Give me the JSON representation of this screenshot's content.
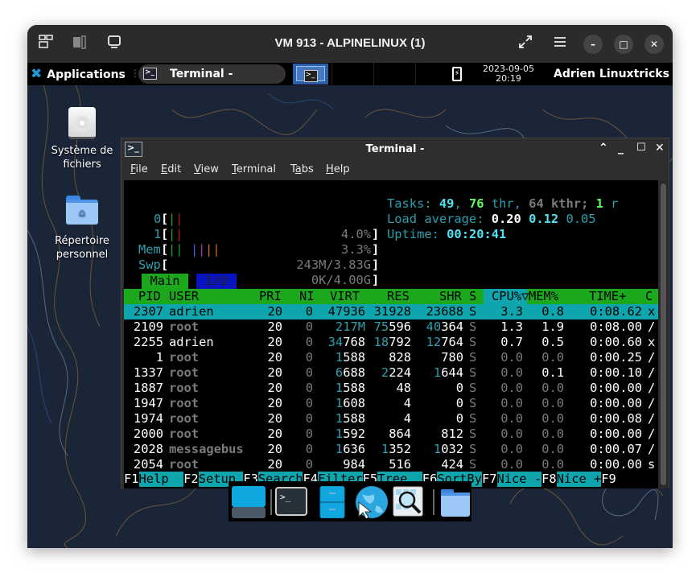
{
  "vm_window": {
    "title": "VM 913 - ALPINELINUX (1)",
    "left_icons": [
      "multi-screen-icon",
      "audio-device-icon",
      "monitor-icon"
    ],
    "right_icons": [
      "fullscreen-icon",
      "hamburger-menu-icon"
    ],
    "controls": {
      "minimize": "–",
      "maximize": "□",
      "close": "✕"
    }
  },
  "panel": {
    "applications_label": "Applications",
    "task_label": "Terminal -",
    "clock_date": "2023-09-05",
    "clock_time": "20:19",
    "user_name": "Adrien Linuxtricks"
  },
  "desktop_icons": [
    {
      "label_line1": "Système de",
      "label_line2": "fichiers",
      "icon": "hard-drive-icon"
    },
    {
      "label_line1": "Répertoire",
      "label_line2": "personnel",
      "icon": "home-folder-icon"
    }
  ],
  "terminal": {
    "title": "Terminal -",
    "menu": [
      {
        "label": "File",
        "mnemonic_index": 0
      },
      {
        "label": "Edit",
        "mnemonic_index": 0
      },
      {
        "label": "View",
        "mnemonic_index": 0
      },
      {
        "label": "Terminal",
        "mnemonic_index": 0
      },
      {
        "label": "Tabs",
        "mnemonic_index": 1
      },
      {
        "label": "Help",
        "mnemonic_index": 0
      }
    ]
  },
  "htop": {
    "cpu0": {
      "label": "0",
      "percent": "4.0%"
    },
    "cpu1": {
      "label": "1",
      "percent": "3.3%"
    },
    "mem": {
      "label": "Mem",
      "value": "243M/3.83G"
    },
    "swp": {
      "label": "Swp",
      "value": "0K/4.00G"
    },
    "tasks": {
      "label": "Tasks:",
      "count": "49",
      "thr": "76",
      "thr_label": "thr,",
      "kthr": "64 kthr;",
      "running": "1",
      "running_label": "r"
    },
    "load": {
      "label": "Load average:",
      "l1": "0.20",
      "l5": "0.12",
      "l15": "0.05"
    },
    "uptime": {
      "label": "Uptime:",
      "value": "00:20:41"
    },
    "tabs": [
      "Main",
      "I/O"
    ],
    "columns": [
      "PID",
      "USER",
      "PRI",
      "NI",
      "VIRT",
      "RES",
      "SHR",
      "S",
      "CPU%▽",
      "MEM%",
      "TIME+",
      "C"
    ],
    "processes": [
      {
        "pid": "2307",
        "user": "adrien",
        "pri": "20",
        "ni": "0",
        "virt": "47936",
        "res": "31928",
        "shr": "23688",
        "s": "S",
        "cpu": "3.3",
        "mem": "0.8",
        "time": "0:08.62",
        "cmd": "x",
        "selected": true
      },
      {
        "pid": "2109",
        "user": "root",
        "pri": "20",
        "ni": "0",
        "virt": "217M",
        "res": "75596",
        "shr": "40364",
        "s": "S",
        "cpu": "1.3",
        "mem": "1.9",
        "time": "0:08.00",
        "cmd": "/"
      },
      {
        "pid": "2255",
        "user": "adrien",
        "pri": "20",
        "ni": "0",
        "virt": "34768",
        "res": "18792",
        "shr": "12764",
        "s": "S",
        "cpu": "0.7",
        "mem": "0.5",
        "time": "0:00.60",
        "cmd": "x"
      },
      {
        "pid": "1",
        "user": "root",
        "pri": "20",
        "ni": "0",
        "virt": "1588",
        "res": "828",
        "shr": "780",
        "s": "S",
        "cpu": "0.0",
        "mem": "0.0",
        "time": "0:00.25",
        "cmd": "/"
      },
      {
        "pid": "1337",
        "user": "root",
        "pri": "20",
        "ni": "0",
        "virt": "6688",
        "res": "2224",
        "shr": "1644",
        "s": "S",
        "cpu": "0.0",
        "mem": "0.1",
        "time": "0:00.10",
        "cmd": "/"
      },
      {
        "pid": "1887",
        "user": "root",
        "pri": "20",
        "ni": "0",
        "virt": "1588",
        "res": "48",
        "shr": "0",
        "s": "S",
        "cpu": "0.0",
        "mem": "0.0",
        "time": "0:00.00",
        "cmd": "/"
      },
      {
        "pid": "1947",
        "user": "root",
        "pri": "20",
        "ni": "0",
        "virt": "1608",
        "res": "4",
        "shr": "0",
        "s": "S",
        "cpu": "0.0",
        "mem": "0.0",
        "time": "0:00.00",
        "cmd": "/"
      },
      {
        "pid": "1974",
        "user": "root",
        "pri": "20",
        "ni": "0",
        "virt": "1588",
        "res": "4",
        "shr": "0",
        "s": "S",
        "cpu": "0.0",
        "mem": "0.0",
        "time": "0:00.08",
        "cmd": "/"
      },
      {
        "pid": "2000",
        "user": "root",
        "pri": "20",
        "ni": "0",
        "virt": "1592",
        "res": "864",
        "shr": "812",
        "s": "S",
        "cpu": "0.0",
        "mem": "0.0",
        "time": "0:00.00",
        "cmd": "/"
      },
      {
        "pid": "2028",
        "user": "messagebus",
        "pri": "20",
        "ni": "0",
        "virt": "1636",
        "res": "1352",
        "shr": "1032",
        "s": "S",
        "cpu": "0.0",
        "mem": "0.0",
        "time": "0:00.07",
        "cmd": "/"
      },
      {
        "pid": "2054",
        "user": "root",
        "pri": "20",
        "ni": "0",
        "virt": "984",
        "res": "516",
        "shr": "424",
        "s": "S",
        "cpu": "0.0",
        "mem": "0.0",
        "time": "0:00.00",
        "cmd": "s"
      }
    ],
    "function_keys": [
      {
        "key": "F1",
        "label": "Help  "
      },
      {
        "key": "F2",
        "label": "Setup "
      },
      {
        "key": "F3",
        "label": "Search"
      },
      {
        "key": "F4",
        "label": "Filter"
      },
      {
        "key": "F5",
        "label": "Tree  "
      },
      {
        "key": "F6",
        "label": "SortBy"
      },
      {
        "key": "F7",
        "label": "Nice -"
      },
      {
        "key": "F8",
        "label": "Nice +"
      },
      {
        "key": "F9",
        "label": ""
      }
    ]
  },
  "dock": [
    {
      "name": "show-desktop",
      "icon": "show-desktop-icon"
    },
    {
      "name": "terminal",
      "icon": "terminal-icon"
    },
    {
      "name": "file-cabinet",
      "icon": "file-manager-icon"
    },
    {
      "name": "web-browser",
      "icon": "web-browser-icon"
    },
    {
      "name": "app-finder",
      "icon": "app-finder-icon"
    },
    {
      "name": "home-folder",
      "icon": "folder-icon"
    }
  ]
}
